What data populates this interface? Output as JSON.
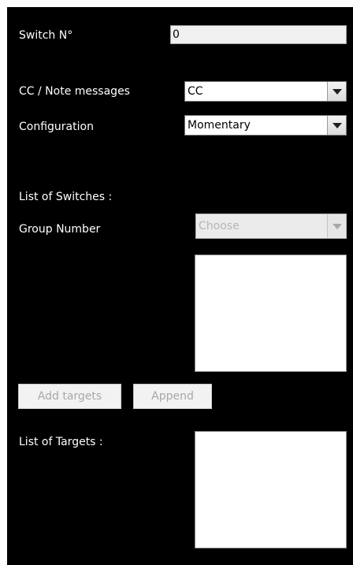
{
  "switch": {
    "label": "Switch N°",
    "value": "0"
  },
  "cc_note": {
    "label": "CC / Note messages",
    "selected": "CC"
  },
  "configuration": {
    "label": "Configuration",
    "selected": "Momentary"
  },
  "switches_list": {
    "label": "List of Switches :"
  },
  "group_number": {
    "label": "Group Number",
    "placeholder": "Choose"
  },
  "buttons": {
    "add_targets": "Add targets",
    "append": "Append"
  },
  "targets_list": {
    "label": "List of Targets :"
  },
  "colors": {
    "panel_background": "#000000",
    "label_text": "#ffffff",
    "disabled_text": "#a8a8a8"
  },
  "icons": {
    "dropdown": "chevron-down-icon"
  }
}
